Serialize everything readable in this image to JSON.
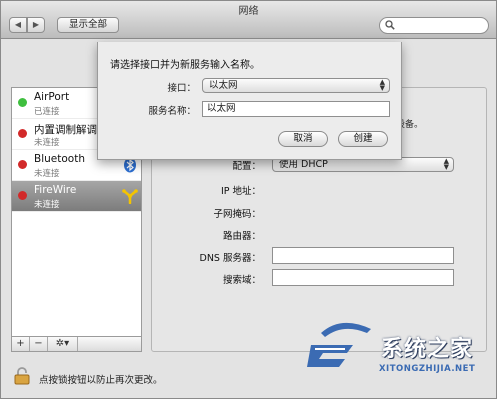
{
  "window": {
    "title": "网络"
  },
  "toolbar": {
    "back_glyph": "◀",
    "forward_glyph": "▶",
    "show_all_label": "显示全部",
    "search_icon": "search-icon"
  },
  "sheet": {
    "prompt": "请选择接口并为新服务输入名称。",
    "interface_label": "接口：",
    "interface_value": "以太网",
    "service_name_label": "服务名称：",
    "service_name_value": "以太网",
    "cancel_label": "取消",
    "create_label": "创建"
  },
  "services": [
    {
      "name": "AirPort",
      "status": "已连接",
      "dot_color": "#3fbf3f",
      "icon": "wifi-icon"
    },
    {
      "name": "内置调制解调器",
      "status": "未连接",
      "dot_color": "#d22a2a",
      "icon": "phone-icon"
    },
    {
      "name": "Bluetooth",
      "status": "未连接",
      "dot_color": "#d22a2a",
      "icon": "bluetooth-icon"
    },
    {
      "name": "FireWire",
      "status": "未连接",
      "dot_color": "#d22a2a",
      "icon": "firewire-icon",
      "selected": true
    }
  ],
  "list_toolbar": {
    "add": "+",
    "remove": "−",
    "action": "✲▾"
  },
  "detail": {
    "note": "设备。",
    "config_label": "配置：",
    "config_value": "使用 DHCP",
    "ip_label": "IP 地址：",
    "subnet_label": "子网掩码：",
    "router_label": "路由器：",
    "dns_label": "DNS 服务器：",
    "search_domains_label": "搜索域："
  },
  "footer": {
    "lock_text": "点按锁按钮以防止再次更改。"
  },
  "watermark": {
    "brand": "系统之家",
    "url": "XITONGZHIJIA.NET"
  }
}
